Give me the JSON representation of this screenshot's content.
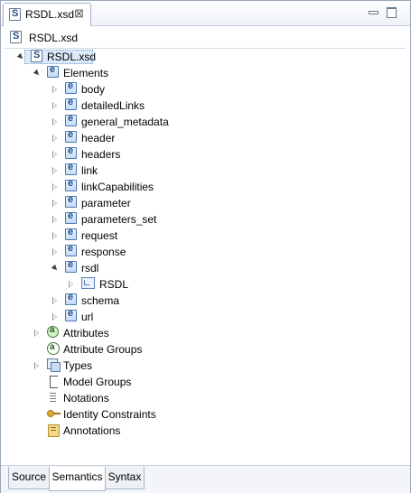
{
  "editor_tab": {
    "title": "RSDL.xsd",
    "close_glyph": "⊠"
  },
  "header": {
    "title": "RSDL.xsd"
  },
  "tree": {
    "root": "RSDL.xsd",
    "elements_label": "Elements",
    "elements": [
      "body",
      "detailedLinks",
      "general_metadata",
      "header",
      "headers",
      "link",
      "linkCapabilities",
      "parameter",
      "parameters_set",
      "request",
      "response",
      "rsdl",
      "schema",
      "url"
    ],
    "rsdl_child": "RSDL",
    "categories": [
      "Attributes",
      "Attribute Groups",
      "Types",
      "Model Groups",
      "Notations",
      "Identity Constraints",
      "Annotations"
    ]
  },
  "bottom_tabs": [
    "Source",
    "Semantics",
    "Syntax"
  ],
  "active_bottom_tab": "Semantics",
  "icons": {
    "schema": "schema-icon",
    "element": "element-icon",
    "complex_type": "complex-type-icon",
    "attribute": "attribute-icon",
    "attribute_group": "attribute-group-icon",
    "types": "types-icon",
    "model_groups": "model-group-icon",
    "notations": "notation-icon",
    "identity_constraints": "key-icon",
    "annotations": "annotation-icon"
  }
}
